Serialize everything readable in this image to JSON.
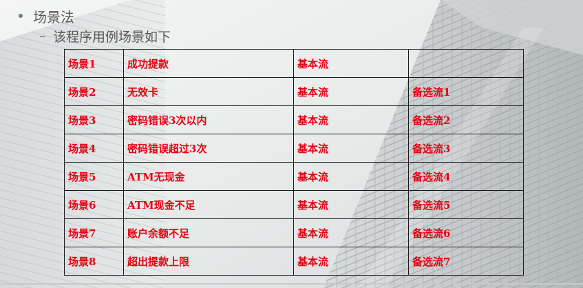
{
  "slide": {
    "bullet_text": "场景法",
    "sub_dash": "–",
    "sub_text": "该程序用例场景如下"
  },
  "table": {
    "rows": [
      [
        "场景1",
        "成功提款",
        "基本流",
        ""
      ],
      [
        "场景2",
        "无效卡",
        "基本流",
        "备选流1"
      ],
      [
        "场景3",
        "密码错误3次以内",
        "基本流",
        "备选流2"
      ],
      [
        "场景4",
        "密码错误超过3次",
        "基本流",
        "备选流3"
      ],
      [
        "场景5",
        "ATM无现金",
        "基本流",
        "备选流4"
      ],
      [
        "场景6",
        "ATM现金不足",
        "基本流",
        "备选流5"
      ],
      [
        "场景7",
        "账户余额不足",
        "基本流",
        "备选流6"
      ],
      [
        "场景8",
        "超出提款上限",
        "基本流",
        "备选流7"
      ]
    ]
  },
  "colors": {
    "cell_text": "#e60012",
    "body_text": "#595959",
    "border": "#1a1a1a"
  }
}
